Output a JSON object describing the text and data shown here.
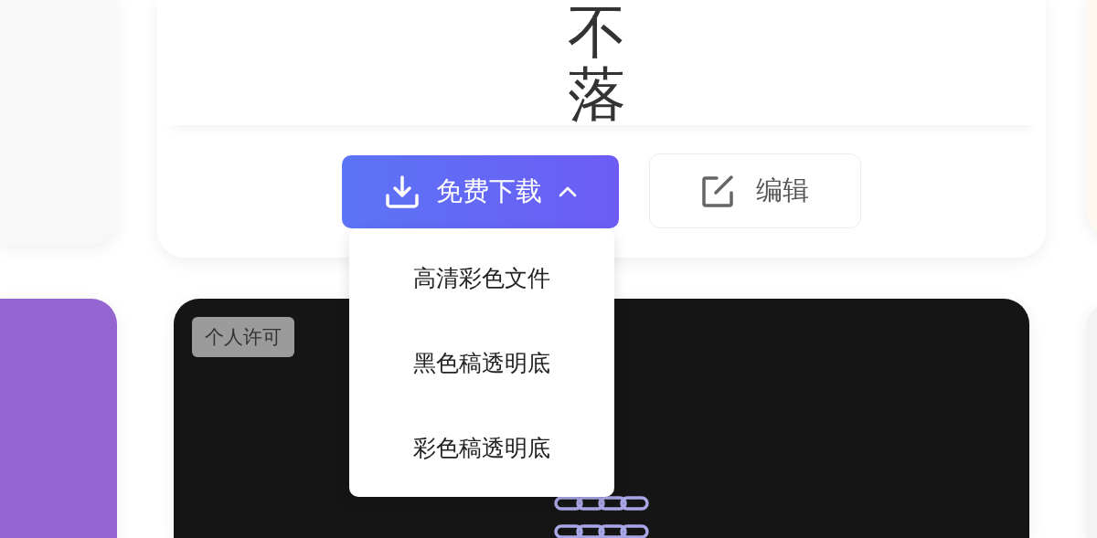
{
  "preview_card": {
    "logo_lines": [
      "不",
      "落"
    ]
  },
  "actions": {
    "download": {
      "label": "免费下载",
      "expanded": true
    },
    "edit": {
      "label": "编辑"
    }
  },
  "download_menu": {
    "items": [
      {
        "label": "高清彩色文件"
      },
      {
        "label": "黑色稿透明底"
      },
      {
        "label": "彩色稿透明底"
      }
    ]
  },
  "license_card": {
    "badge": "个人许可"
  }
}
